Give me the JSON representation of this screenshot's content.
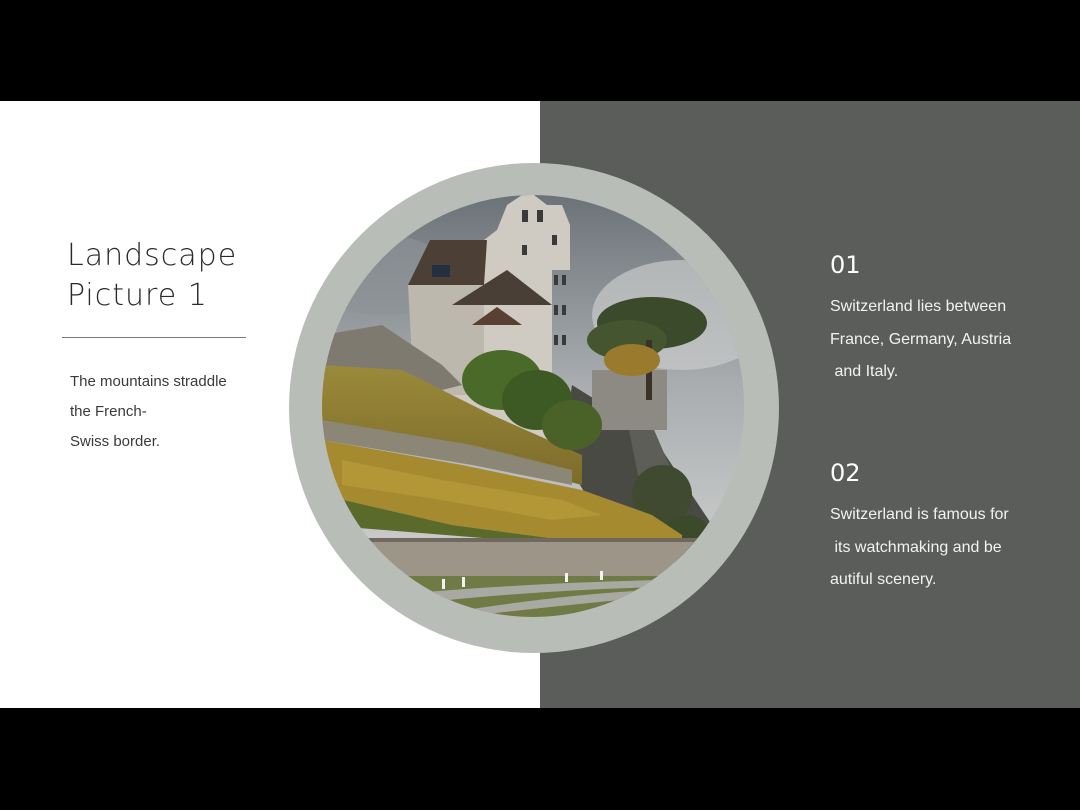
{
  "slide": {
    "title_lines": [
      "Landscape",
      "Picture 1"
    ],
    "caption_lines": [
      "The mountains straddle",
      "the French-",
      "Swiss border."
    ]
  },
  "items": [
    {
      "number": "01",
      "text_lines": [
        "Switzerland lies between",
        "France, Germany, Austria",
        " and Italy."
      ]
    },
    {
      "number": "02",
      "text_lines": [
        "Switzerland is famous for",
        " its watchmaking and be",
        "autiful scenery."
      ]
    }
  ],
  "colors": {
    "letterbox": "#000000",
    "left_bg": "#ffffff",
    "right_bg": "#5b5d5a",
    "ring": "#b9bdb8",
    "title_text": "#2a2a2a",
    "item_text": "#ffffff"
  },
  "image": {
    "subject": "castle-on-vineyard-hillside"
  }
}
